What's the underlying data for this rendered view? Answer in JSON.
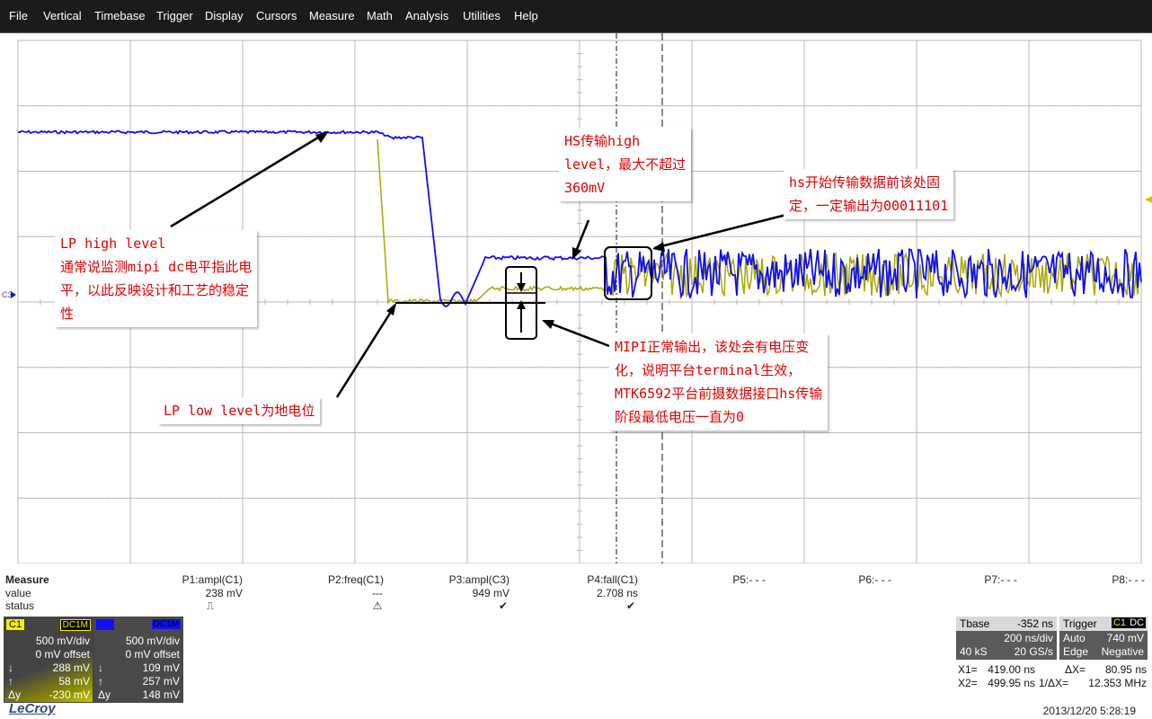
{
  "menu": [
    "File",
    "Vertical",
    "Timebase",
    "Trigger",
    "Display",
    "Cursors",
    "Measure",
    "Math",
    "Analysis",
    "Utilities",
    "Help"
  ],
  "colors": {
    "c1": "#f8f800",
    "c3": "#1010f0",
    "c1_trace": "#a8a800",
    "grid": "#b8b8b8",
    "annotation": "#e00000"
  },
  "ground_marker": "C3",
  "annotations": {
    "lp_high": [
      "LP high level",
      "通常说监测mipi dc电平指此电",
      "平，以此反映设计和工艺的稳定",
      "性"
    ],
    "lp_low": [
      "LP low level为地电位"
    ],
    "hs_high": [
      "HS传输high",
      "level，最大不超过",
      "360mV"
    ],
    "hs_start": [
      "hs开始传输数据前该处固",
      "定，一定输出为00011101"
    ],
    "mipi_normal": [
      "MIPI正常输出，该处会有电压变",
      "化，说明平台terminal生效，",
      "MTK6592平台前摄数据接口hs传输",
      "阶段最低电压一直为0"
    ]
  },
  "measure": {
    "title": "Measure",
    "value_label": "value",
    "status_label": "status",
    "params": [
      {
        "name": "P1:ampl(C1)",
        "value": "238 mV",
        "status": "⎍"
      },
      {
        "name": "P2:freq(C1)",
        "value": "---",
        "status": "⚠"
      },
      {
        "name": "P3:ampl(C3)",
        "value": "949 mV",
        "status": "✔"
      },
      {
        "name": "P4:fall(C1)",
        "value": "2.708 ns",
        "status": "✔"
      },
      {
        "name": "P5:- - -",
        "value": "",
        "status": ""
      },
      {
        "name": "P6:- - -",
        "value": "",
        "status": ""
      },
      {
        "name": "P7:- - -",
        "value": "",
        "status": ""
      },
      {
        "name": "P8:- - -",
        "value": "",
        "status": ""
      }
    ]
  },
  "channels": {
    "c1": {
      "name": "C1",
      "coupling": "DC1M",
      "vdiv": "500 mV/div",
      "offset": "0 mV offset",
      "down_arrow": "↓",
      "down": "288 mV",
      "up_arrow": "↑",
      "up": "58 mV",
      "delta_label": "Δy",
      "delta": "-230 mV"
    },
    "c3": {
      "name": "C3",
      "coupling": "DC1M",
      "vdiv": "500 mV/div",
      "offset": "0 mV offset",
      "down_arrow": "↓",
      "down": "109 mV",
      "up_arrow": "↑",
      "up": "257 mV",
      "delta_label": "Δy",
      "delta": "148 mV"
    }
  },
  "timebase": {
    "label": "Tbase",
    "delay": "-352 ns",
    "tdiv": "200 ns/div",
    "samples": "40 kS",
    "rate": "20 GS/s"
  },
  "trigger": {
    "label": "Trigger",
    "tag": "C1",
    "coupling": "DC",
    "mode": "Auto",
    "level": "740 mV",
    "type": "Edge",
    "slope": "Negative"
  },
  "cursors": {
    "x1_label": "X1=",
    "x1": "419.00 ns",
    "dx_label": "ΔX=",
    "dx": "80.95 ns",
    "x2_label": "X2=",
    "x2": "499.95 ns",
    "inv_label": "1/ΔX=",
    "inv": "12.353 MHz"
  },
  "brand": "LeCroy",
  "datetime": "2013/12/20 5:28:19"
}
